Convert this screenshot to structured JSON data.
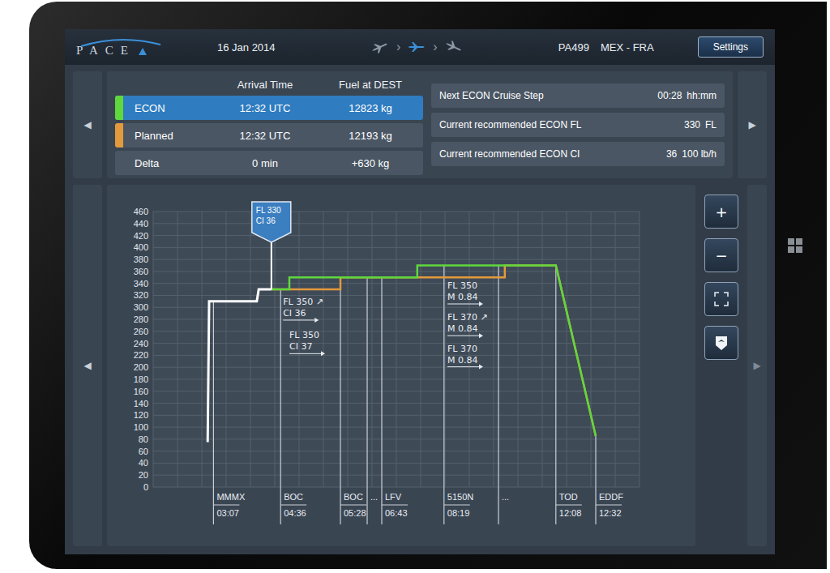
{
  "header": {
    "logo": "PACE",
    "date": "16 Jan 2014",
    "phases": [
      {
        "name": "climb",
        "selected": false
      },
      {
        "name": "cruise",
        "selected": true
      },
      {
        "name": "descent",
        "selected": false
      }
    ],
    "separator": "›",
    "flight": "PA499",
    "route": "MEX - FRA",
    "settings": "Settings"
  },
  "summary": {
    "prev": "◀",
    "next": "▶",
    "columns": [
      "Arrival Time",
      "Fuel at DEST"
    ],
    "rows": [
      {
        "label": "ECON",
        "arrival": "12:32 UTC",
        "fuel": "12823 kg",
        "color": "#5fd83c",
        "selected": true
      },
      {
        "label": "Planned",
        "arrival": "12:32 UTC",
        "fuel": "12193 kg",
        "color": "#e39a3c",
        "selected": false
      },
      {
        "label": "Delta",
        "arrival": "0 min",
        "fuel": "+630 kg",
        "selected": false
      }
    ]
  },
  "info": [
    {
      "label": "Next ECON Cruise Step",
      "value": "00:28",
      "unit": "hh:mm"
    },
    {
      "label": "Current recommended ECON FL",
      "value": "330",
      "unit": "FL"
    },
    {
      "label": "Current recommended ECON CI",
      "value": "36",
      "unit": "100 lb/h"
    }
  ],
  "chart": {
    "prev": "◀",
    "next": "▶",
    "y_max": 460,
    "x_max": 1000,
    "y_ticks": [
      "460",
      "440",
      "420",
      "400",
      "380",
      "360",
      "340",
      "320",
      "300",
      "280",
      "260",
      "240",
      "220",
      "200",
      "180",
      "160",
      "140",
      "120",
      "100",
      "80",
      "60",
      "40",
      "20",
      "0"
    ],
    "series": [
      {
        "name": "planned",
        "color": "#e39a3c",
        "points": [
          [
            243,
            330
          ],
          [
            385,
            330
          ],
          [
            385,
            350
          ],
          [
            723,
            350
          ],
          [
            723,
            370
          ],
          [
            828,
            370
          ],
          [
            910,
            85
          ]
        ]
      },
      {
        "name": "econ",
        "color": "#5fd83c",
        "points": [
          [
            243,
            330
          ],
          [
            280,
            330
          ],
          [
            280,
            350
          ],
          [
            543,
            350
          ],
          [
            543,
            370
          ],
          [
            828,
            370
          ],
          [
            910,
            85
          ]
        ]
      },
      {
        "name": "flown",
        "color": "#ffffff",
        "points": [
          [
            112,
            75
          ],
          [
            115,
            310
          ],
          [
            213,
            310
          ],
          [
            217,
            330
          ],
          [
            243,
            330
          ]
        ]
      }
    ],
    "callout": {
      "x": 243,
      "fl": 330,
      "lines": [
        "FL 330",
        "CI 36"
      ]
    },
    "annotations": [
      {
        "x": 267,
        "fl": 318,
        "lines": [
          "FL 350 ↗",
          "CI 36"
        ],
        "arrow": true
      },
      {
        "x": 280,
        "fl": 262,
        "lines": [
          "FL 350",
          "CI 37"
        ],
        "arrow": true
      },
      {
        "x": 605,
        "fl": 345,
        "lines": [
          "FL 350",
          "M 0.84"
        ],
        "arrow": true
      },
      {
        "x": 605,
        "fl": 292,
        "lines": [
          "FL 370 ↗",
          "M 0.84"
        ],
        "arrow": true
      },
      {
        "x": 605,
        "fl": 240,
        "lines": [
          "FL 370",
          "M 0.84"
        ],
        "arrow": true
      }
    ],
    "waypoints": [
      {
        "name": "MMMX",
        "time": "03:07",
        "x": 124
      },
      {
        "name": "BOC",
        "time": "04:36",
        "x": 262
      },
      {
        "name": "BOC",
        "time": "05:28",
        "x": 385
      },
      {
        "name": "...",
        "x": 440
      },
      {
        "name": "LFV",
        "time": "06:43",
        "x": 470
      },
      {
        "name": "5150N",
        "time": "08:19",
        "x": 598
      },
      {
        "name": "...",
        "x": 710
      },
      {
        "name": "TOD",
        "time": "12:08",
        "x": 828
      },
      {
        "name": "EDDF",
        "time": "12:32",
        "x": 910
      }
    ],
    "controls": [
      {
        "kind": "zoom-in",
        "label": "+"
      },
      {
        "kind": "zoom-out",
        "label": "−"
      },
      {
        "kind": "fit"
      },
      {
        "kind": "export"
      }
    ]
  }
}
